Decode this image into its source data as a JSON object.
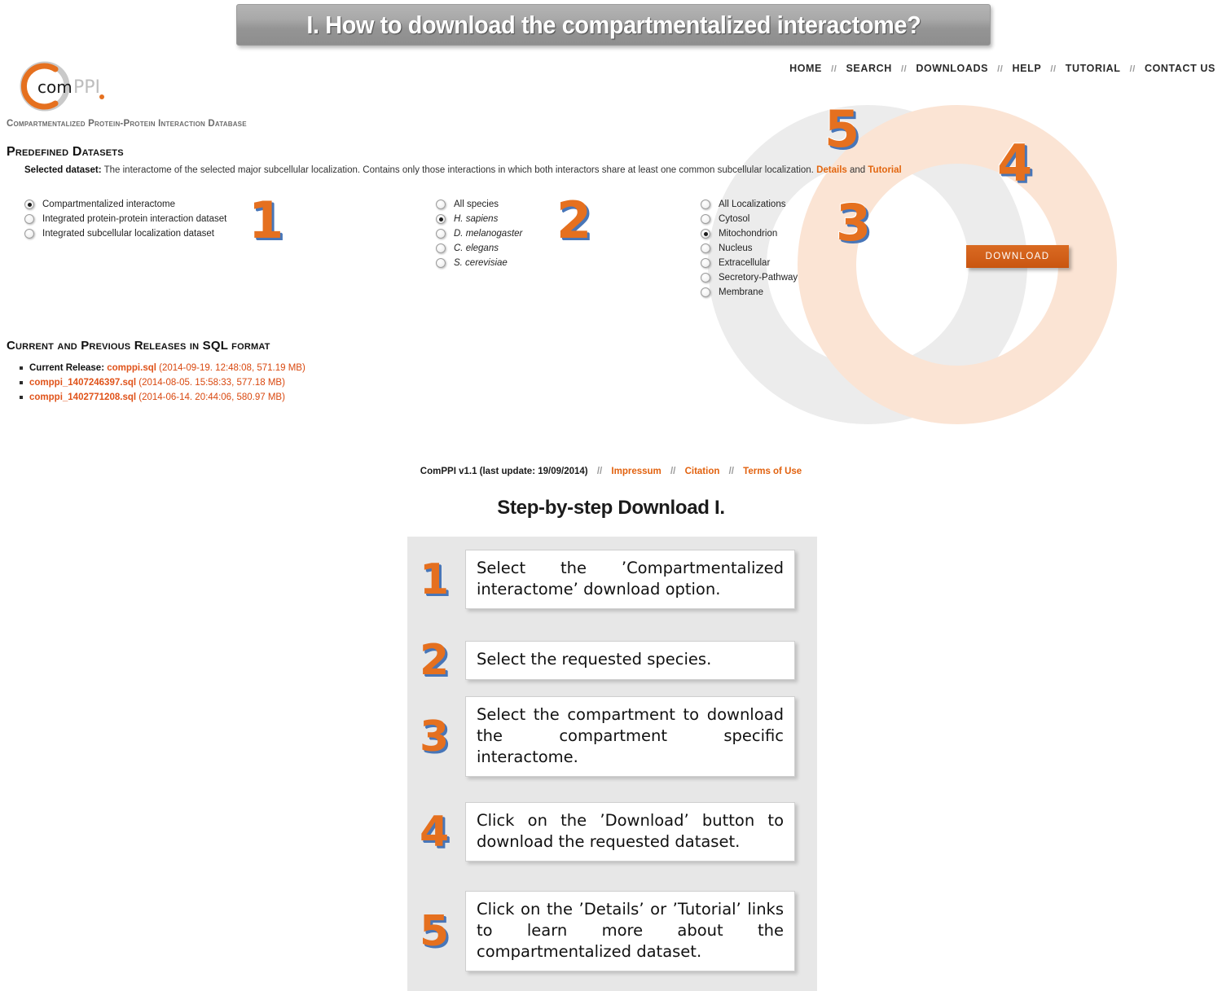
{
  "banner": {
    "title": "I. How to download the compartmentalized interactome?"
  },
  "topnav": {
    "items": [
      "HOME",
      "SEARCH",
      "DOWNLOADS",
      "HELP",
      "TUTORIAL",
      "CONTACT US"
    ],
    "separator": "//"
  },
  "logo": {
    "text_com": "com",
    "text_ppi": "PPI",
    "tagline": "Compartmentalized Protein-Protein Interaction Database"
  },
  "predefined": {
    "heading": "Predefined Datasets",
    "selected_label": "Selected dataset:",
    "selected_text": "The interactome of the selected major subcellular localization. Contains only those interactions in which both interactors share at least one common subcellular localization.",
    "details_link": "Details",
    "and_word": "and",
    "tutorial_link": "Tutorial"
  },
  "dataset_options": {
    "items": [
      {
        "label": "Compartmentalized interactome",
        "checked": true
      },
      {
        "label": "Integrated protein-protein interaction dataset",
        "checked": false
      },
      {
        "label": "Integrated subcellular localization dataset",
        "checked": false
      }
    ]
  },
  "species_options": {
    "items": [
      {
        "label": "All species",
        "checked": false,
        "italic": false
      },
      {
        "label": "H. sapiens",
        "checked": true,
        "italic": true
      },
      {
        "label": "D. melanogaster",
        "checked": false,
        "italic": true
      },
      {
        "label": "C. elegans",
        "checked": false,
        "italic": true
      },
      {
        "label": "S. cerevisiae",
        "checked": false,
        "italic": true
      }
    ]
  },
  "localization_options": {
    "items": [
      {
        "label": "All Localizations",
        "checked": false
      },
      {
        "label": "Cytosol",
        "checked": false
      },
      {
        "label": "Mitochondrion",
        "checked": true
      },
      {
        "label": "Nucleus",
        "checked": false
      },
      {
        "label": "Extracellular",
        "checked": false
      },
      {
        "label": "Secretory-Pathway",
        "checked": false
      },
      {
        "label": "Membrane",
        "checked": false
      }
    ]
  },
  "callouts": {
    "one": "1",
    "two": "2",
    "three": "3",
    "four": "4",
    "five": "5"
  },
  "download_button": {
    "label": "DOWNLOAD"
  },
  "releases": {
    "heading": "Current and Previous Releases in SQL format",
    "items": [
      {
        "prefix": "Current Release: ",
        "file": "comppi.sql",
        "meta": " (2014-09-19. 12:48:08, 571.19 MB)"
      },
      {
        "prefix": "",
        "file": "comppi_1407246397.sql",
        "meta": " (2014-08-05. 15:58:33, 577.18 MB)"
      },
      {
        "prefix": "",
        "file": "comppi_1402771208.sql",
        "meta": " (2014-06-14. 20:44:06, 580.97 MB)"
      }
    ]
  },
  "site_footer": {
    "version": "ComPPI v1.1 (last update: 19/09/2014)",
    "separator": "//",
    "links": [
      "Impressum",
      "Citation",
      "Terms of Use"
    ]
  },
  "steps_section": {
    "title": "Step-by-step Download I.",
    "steps": [
      {
        "num": "1",
        "text": "Select the ’Compartmentalized interactome’ download option."
      },
      {
        "num": "2",
        "text": "Select the requested species."
      },
      {
        "num": "3",
        "text": "Select the compartment to download the compartment specific interactome."
      },
      {
        "num": "4",
        "text": "Click on the ’Download’ button to download the requested dataset."
      },
      {
        "num": "5",
        "text": "Click on the ’Details’ or ’Tutorial’ links to learn more about the compartmentalized dataset."
      }
    ]
  },
  "colors": {
    "accent_orange": "#e5701f",
    "link_orange": "#e2620f",
    "callout_shadow_blue": "#4876b8",
    "banner_gray": "#a0a0a0",
    "panel_gray": "#e7e7e7"
  }
}
